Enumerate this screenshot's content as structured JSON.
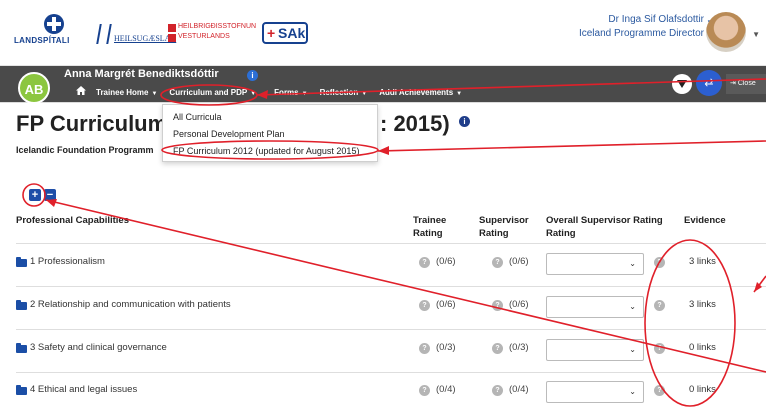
{
  "header": {
    "logos": {
      "landspitali": "LANDSPÍTALI",
      "heilsugaeslan": "HEILSUGÆSLAN",
      "hve_line1": "HEILBRIGÐISSTOFNUN",
      "hve_line2": "VESTURLANDS",
      "sak": "SAk"
    },
    "user_name": "Dr Inga Sif Olafsdottir",
    "user_role": "Iceland Programme Director"
  },
  "trainee": {
    "initials": "AB",
    "name": "Anna Margrét Benediktsdóttir",
    "info": "i"
  },
  "nav": {
    "items": [
      {
        "label": "Trainee Home"
      },
      {
        "label": "Curriculum and PDP"
      },
      {
        "label": "Forms"
      },
      {
        "label": "Reflection"
      },
      {
        "label": "Addl Achievements"
      }
    ],
    "close_label": "Close"
  },
  "dropdown": {
    "items": [
      "All Curricula",
      "Personal Development Plan",
      "FP Curriculum 2012 (updated for August 2015)"
    ]
  },
  "page": {
    "title_left": "FP Curriculum 2",
    "title_right": ": 2015)",
    "subtitle": "Icelandic Foundation Programm"
  },
  "controls": {
    "expand": "+",
    "collapse": "−"
  },
  "table": {
    "headers": {
      "capability": "Professional Capabilities",
      "trainee_line1": "Trainee",
      "trainee_line2": "Rating",
      "supervisor_line1": "Supervisor",
      "supervisor_line2": "Rating",
      "overall_line1": "Overall Supervisor Rating",
      "overall_line2": "Rating",
      "evidence": "Evidence"
    },
    "rows": [
      {
        "label": "1 Professionalism",
        "trainee": "(0/6)",
        "supervisor": "(0/6)",
        "evidence": "3 links"
      },
      {
        "label": "2 Relationship and communication with patients",
        "trainee": "(0/6)",
        "supervisor": "(0/6)",
        "evidence": "3 links"
      },
      {
        "label": "3 Safety and clinical governance",
        "trainee": "(0/3)",
        "supervisor": "(0/3)",
        "evidence": "0 links"
      },
      {
        "label": "4 Ethical and legal issues",
        "trainee": "(0/4)",
        "supervisor": "(0/4)",
        "evidence": "0 links"
      }
    ]
  },
  "colors": {
    "nav_bg": "#4a4a4a",
    "brand_blue": "#16418f",
    "annotation_red": "#e0202a",
    "initials_green": "#8cc63f"
  }
}
